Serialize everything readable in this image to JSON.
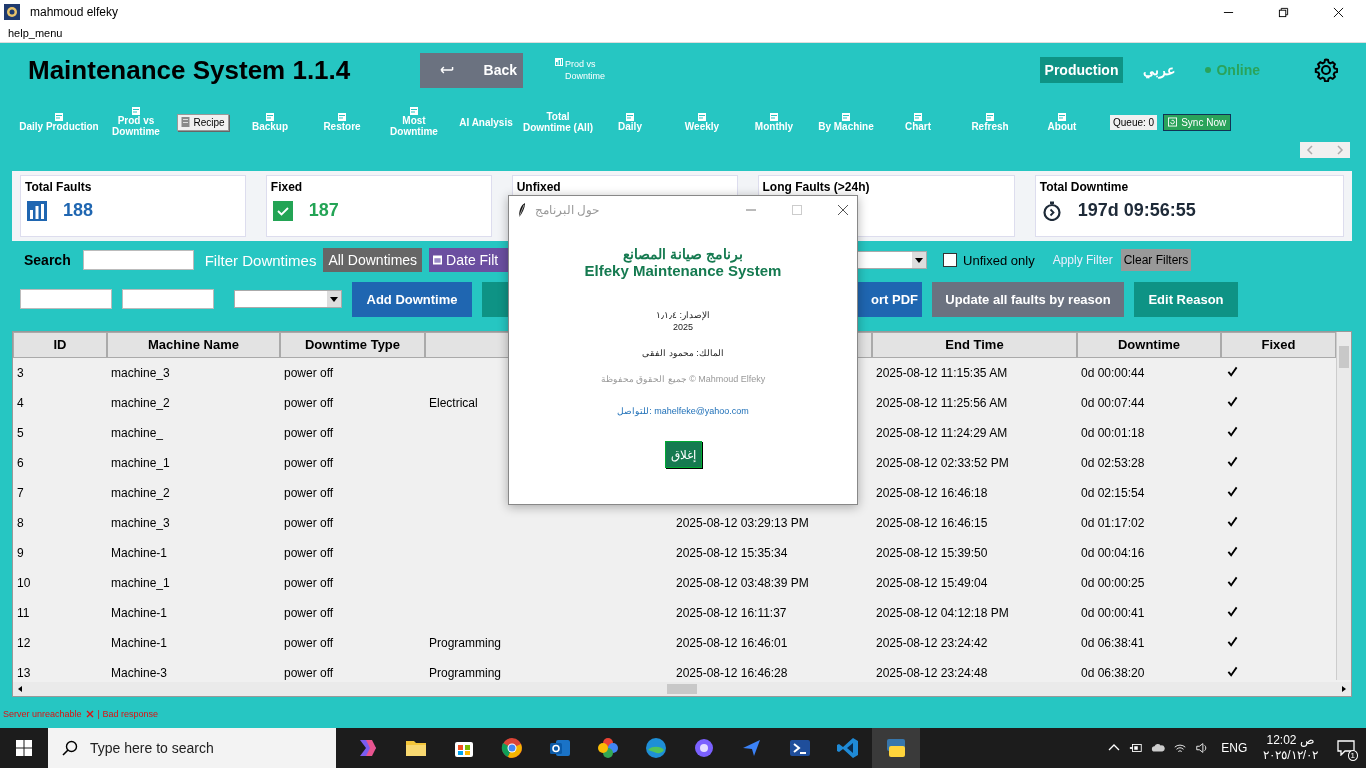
{
  "window": {
    "title": "mahmoud elfeky"
  },
  "menu": [
    "help_menu"
  ],
  "header": {
    "title": "Maintenance System 1.1.4",
    "back_button": "Back",
    "prod_link": "Prod vs Downtime",
    "mode_badge": "Production",
    "language": "عربي",
    "status": "Online"
  },
  "nav": [
    {
      "label": "Daily Production",
      "kind": "link"
    },
    {
      "label": "Prod vs Downtime",
      "kind": "link"
    },
    {
      "label": "Recipe",
      "kind": "raised"
    },
    {
      "label": "Backup",
      "kind": "link"
    },
    {
      "label": "Restore",
      "kind": "link"
    },
    {
      "label": "Most Downtime",
      "kind": "link"
    },
    {
      "label": "AI Analysis",
      "kind": "plain"
    },
    {
      "label": "Total Downtime (All)",
      "kind": "plain"
    },
    {
      "label": "Daily",
      "kind": "link"
    },
    {
      "label": "Weekly",
      "kind": "link"
    },
    {
      "label": "Monthly",
      "kind": "link"
    },
    {
      "label": "By Machine",
      "kind": "link"
    },
    {
      "label": "Chart",
      "kind": "link"
    },
    {
      "label": "Refresh",
      "kind": "link"
    },
    {
      "label": "About",
      "kind": "link"
    },
    {
      "label": "Queue: 0",
      "kind": "counter"
    },
    {
      "label": "Sync Now",
      "kind": "sync"
    }
  ],
  "cards": [
    {
      "label": "Total Faults",
      "value": "188",
      "kind": "total"
    },
    {
      "label": "Fixed",
      "value": "187",
      "kind": "fixed"
    },
    {
      "label": "Unfixed"
    },
    {
      "label": "Long Faults (>24h)"
    },
    {
      "label": "Total Downtime",
      "value": "197d 09:56:55",
      "kind": "time"
    }
  ],
  "filters": {
    "search_label": "Search",
    "filter_label": "Filter Downtimes",
    "all_button": "All Downtimes",
    "date_button": "Date Filt",
    "unfixed_only": {
      "label": "Unfixed only",
      "checked": false
    },
    "apply": "Apply Filter",
    "clear": "Clear Filters"
  },
  "actions": [
    {
      "label": "Add Downtime",
      "kind": "blue"
    },
    {
      "kind": "teal"
    },
    {
      "label": "ort PDF",
      "kind": "blue"
    },
    {
      "label": "Update all faults by reason",
      "kind": "grey"
    },
    {
      "label": "Edit Reason",
      "kind": "teal"
    }
  ],
  "table": {
    "columns": [
      {
        "label": "ID"
      },
      {
        "label": "Machine Name"
      },
      {
        "label": "Downtime Type"
      },
      {},
      {},
      {
        "label": "End Time"
      },
      {
        "label": "Downtime"
      },
      {
        "label": "Fixed"
      }
    ],
    "rows": [
      {
        "id": "3",
        "machine": "machine_3",
        "type": "power off",
        "end": "2025-08-12 11:15:35 AM",
        "downtime": "0d 00:00:44",
        "fixed": true
      },
      {
        "id": "4",
        "machine": "machine_2",
        "type": "power off",
        "column_4": "Electrical",
        "end": "2025-08-12 11:25:56 AM",
        "downtime": "0d 00:07:44",
        "fixed": true
      },
      {
        "id": "5",
        "machine": "machine_",
        "type": "power off",
        "end": "2025-08-12 11:24:29 AM",
        "downtime": "0d 00:01:18",
        "fixed": true
      },
      {
        "id": "6",
        "machine": "machine_1",
        "type": "power off",
        "end": "2025-08-12 02:33:52 PM",
        "downtime": "0d 02:53:28",
        "fixed": true
      },
      {
        "id": "7",
        "machine": "machine_2",
        "type": "power off",
        "end": "2025-08-12 16:46:18",
        "downtime": "0d 02:15:54",
        "fixed": true
      },
      {
        "id": "8",
        "machine": "machine_3",
        "type": "power off",
        "start": "2025-08-12 03:29:13 PM",
        "end": "2025-08-12 16:46:15",
        "downtime": "0d 01:17:02",
        "fixed": true
      },
      {
        "id": "9",
        "machine": "Machine-1",
        "type": "power off",
        "start": "2025-08-12 15:35:34",
        "end": "2025-08-12 15:39:50",
        "downtime": "0d 00:04:16",
        "fixed": true
      },
      {
        "id": "10",
        "machine": "machine_1",
        "type": "power off",
        "start": "2025-08-12 03:48:39 PM",
        "end": "2025-08-12 15:49:04",
        "downtime": "0d 00:00:25",
        "fixed": true
      },
      {
        "id": "11",
        "machine": "Machine-1",
        "type": "power off",
        "start": "2025-08-12 16:11:37",
        "end": "2025-08-12 04:12:18 PM",
        "downtime": "0d 00:00:41",
        "fixed": true
      },
      {
        "id": "12",
        "machine": "Machine-1",
        "type": "power off",
        "column_4": "Programming",
        "start": "2025-08-12 16:46:01",
        "end": "2025-08-12 23:24:42",
        "downtime": "0d 06:38:41",
        "fixed": true
      },
      {
        "id": "13",
        "machine": "Machine-3",
        "type": "power off",
        "column_4": "Programming",
        "start": "2025-08-12 16:46:28",
        "end": "2025-08-12 23:24:48",
        "downtime": "0d 06:38:20",
        "fixed": true
      }
    ]
  },
  "status_bar": {
    "error": "Server unreachable",
    "detail": "| Bad response"
  },
  "dialog": {
    "title": "حول البرنامج",
    "heading_ar": "برنامج صيانة المصانع",
    "heading_en": "Elfeky Maintenance System",
    "version": "الإصدار: ١٫١٫٤",
    "year": "2025",
    "owner": "المالك: محمود الفقى",
    "copyright": "جميع الحقوق محفوظة © Mahmoud Elfeky",
    "contact": "للتواصل: mahelfeke@yahoo.com",
    "close_button": "إغلاق"
  },
  "taskbar": {
    "search_placeholder": "Type here to search",
    "language": "ENG",
    "time": "12:02 ص",
    "date": "٢٠٢٥/١٢/٠٢",
    "notifications": "1"
  }
}
